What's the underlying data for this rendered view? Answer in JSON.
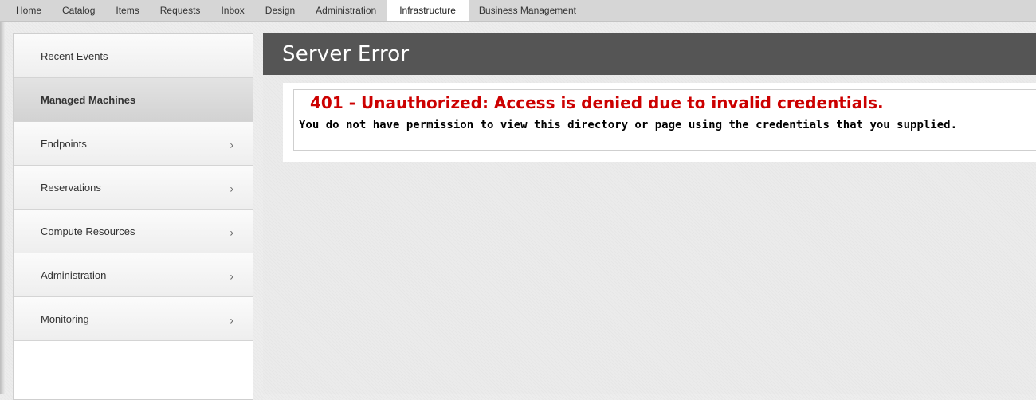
{
  "topnav": {
    "tabs": [
      {
        "label": "Home"
      },
      {
        "label": "Catalog"
      },
      {
        "label": "Items"
      },
      {
        "label": "Requests"
      },
      {
        "label": "Inbox"
      },
      {
        "label": "Design"
      },
      {
        "label": "Administration"
      },
      {
        "label": "Infrastructure",
        "active": true
      },
      {
        "label": "Business Management"
      }
    ]
  },
  "sidebar": {
    "items": [
      {
        "label": "Recent Events",
        "chevron": false
      },
      {
        "label": "Managed Machines",
        "chevron": false,
        "active": true
      },
      {
        "label": "Endpoints",
        "chevron": true
      },
      {
        "label": "Reservations",
        "chevron": true
      },
      {
        "label": "Compute Resources",
        "chevron": true
      },
      {
        "label": "Administration",
        "chevron": true
      },
      {
        "label": "Monitoring",
        "chevron": true
      }
    ],
    "chevron_glyph": "›"
  },
  "content": {
    "header_title": "Server Error",
    "error_title": "401 - Unauthorized: Access is denied due to invalid credentials.",
    "error_description": "You do not have permission to view this directory or page using the credentials that you supplied."
  },
  "colors": {
    "header_bg": "#555555",
    "error_red": "#cc0000",
    "nav_bg": "#d6d6d6"
  }
}
